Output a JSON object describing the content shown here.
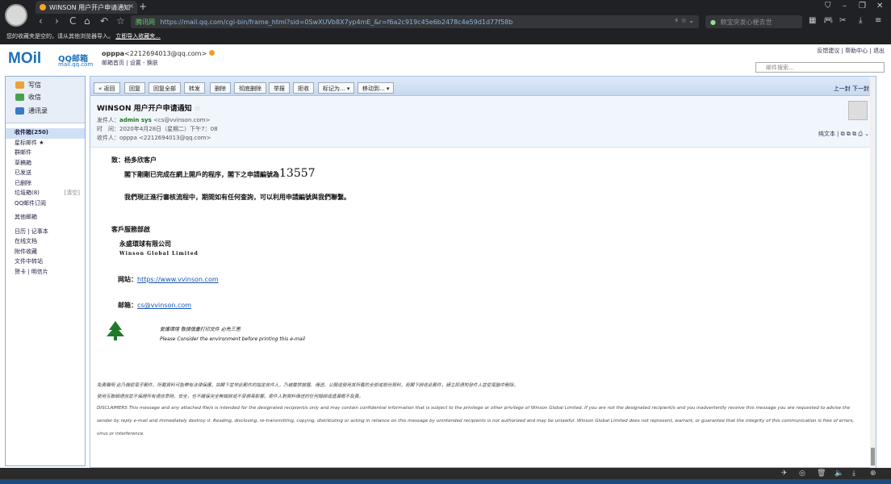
{
  "browser": {
    "tab_title": "WINSON 用户开户申请通知",
    "tab_close": "×",
    "new_tab": "+",
    "win_controls": [
      "⛉",
      "–",
      "❐",
      "✕"
    ],
    "nav": [
      "‹",
      "›",
      "C",
      "⌂",
      "↶",
      "☆"
    ],
    "secure_label": "腾讯网",
    "url": "https://mail.qq.com/cgi-bin/frame_html?sid=0SwXUVb8X7yp4mE_&r=f6a2c919c45e6b2478c4e59d1d77f58b",
    "url_right": "⚡ ☆ ⌄",
    "search_placeholder": "赖宝突发心梗去世",
    "bookmark_text": "您的收藏夹是空的，请从其他浏览器导入。",
    "bookmark_link": "立即导入收藏夹..."
  },
  "header": {
    "logo": "MOil",
    "logo_cn": "QQ邮箱",
    "logo_domain": "mail.qq.com",
    "user_name": "opppa",
    "user_email": "<2212694013@qq.com>",
    "user_links": "邮箱首页 | 设置 - 换肤",
    "top_links": "反馈建议 | 帮助中心 | 退出",
    "search_placeholder": "邮件搜索..."
  },
  "sidebar": {
    "write": "写信",
    "receive": "收信",
    "contacts": "通讯录",
    "items": [
      {
        "label": "收件箱(250)",
        "active": true
      },
      {
        "label": "星标邮件 ★"
      },
      {
        "label": "群邮件"
      },
      {
        "label": "草稿箱"
      },
      {
        "label": "已发送"
      },
      {
        "label": "已删除"
      },
      {
        "label": "垃圾箱(8)",
        "extra": "[清空]"
      },
      {
        "label": "QQ邮件订阅"
      }
    ],
    "others": "其他邮箱",
    "more": [
      "日历 | 记事本",
      "在线文档",
      "附件收藏",
      "文件中转站",
      "贺卡 | 明信片"
    ]
  },
  "toolbar": {
    "buttons": [
      "« 返回",
      "回复",
      "回复全部",
      "转发",
      "删除",
      "彻底删除",
      "举报",
      "拒收",
      "标记为... ▾",
      "移动到... ▾"
    ],
    "nav": "上一封 下一封"
  },
  "mail": {
    "subject": "WINSON 用户开户申请通知",
    "star": "☆",
    "sender_label": "发件人：",
    "sender_name": "admin sys",
    "sender_email": "<cs@vvinson.com>",
    "time_label": "时　间：",
    "time": "2020年4月28日（星期二）下午7：08",
    "recipient_label": "收件人：",
    "recipient": "opppa <2212694013@qq.com>",
    "plain_text": "纯文本 | ⧉ ⧉ ⧉ ⎙ ⌄",
    "greeting": "致：杨多欣客户",
    "line1": "閣下剛剛已完成在網上開戶的程序，閣下之申請編號為",
    "app_number": "13557",
    "line2": "我們現正進行審核流程中，期間如有任何查詢，可以利用申請編號與我們聯繫。",
    "dept": "客戶服務部啟",
    "company_cn": "永盛環球有限公司",
    "company_en": "Winson Global Limited",
    "site_label": "网站：",
    "site_url": "https://www.vvinson.com",
    "mail_label": "邮箱：",
    "mail_addr": "cs@vvinson.com",
    "eco_cn": "愛護環境 敬請慎重打印文件 必先三思",
    "eco_en": "Please Consider the environment before printing this e-mail",
    "disclaimer": [
      "免責聲明 此乃機密電子郵件，所載資料可能帶有法律保護，如閣下並非此郵件的指定收件人，乃被嚴禁披露、傳送、公開或使用其所載的全部或部份資料，若閣下誤收此郵件，請立即通知發件人並從電腦中刪除。",
      "使用互聯網通信並不保證所有通信準時、安全，也不確保完全無錯誤或不受病毒影響。寄件人對資料傳送的任何錯誤或遺漏概不負責。",
      "DISCLAIMERS This message and any attached file/s is intended for the designated recipient/s only and may contain confidential information that is subject to the privilege or other privilege of Winson Global Limited. If you are not the designated recipient/s and you inadvertently receive this message you are requested to advise the",
      "sender by reply e-mail and immediately destroy it. Reading, disclosing, re-transmitting, copying, distributing or acting in reliance on this message by unintended recipients is not authorized and may be unlawful. Winson Global Limited does not represent, warrant, or guarantee that the integrity of this communication is free of errors,",
      "virus or interference."
    ]
  }
}
